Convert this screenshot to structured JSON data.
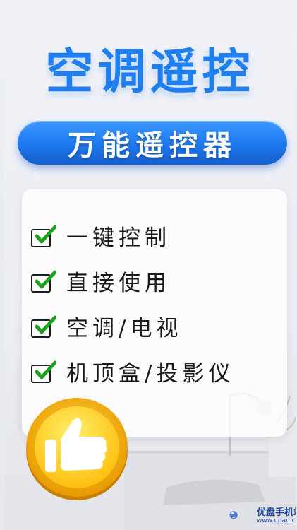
{
  "title": "空调遥控",
  "subtitle": "万能遥控器",
  "features": [
    {
      "label": "一键控制",
      "icon": "checkbox-check-icon"
    },
    {
      "label": "直接使用",
      "icon": "checkbox-check-icon"
    },
    {
      "label": "空调/电视",
      "icon": "checkbox-check-icon"
    },
    {
      "label": "机顶盒/投影仪",
      "icon": "checkbox-check-icon"
    }
  ],
  "badge": {
    "icon": "thumbs-up-icon",
    "colors": {
      "outer": "#f2a900",
      "inner": "#ffd21a"
    }
  },
  "watermark": {
    "name": "优盘手机站",
    "url": "www.upan.cc"
  },
  "colors": {
    "title": "#1f7ff0",
    "pill": "#1e78ee",
    "check": "#1aa01a"
  }
}
